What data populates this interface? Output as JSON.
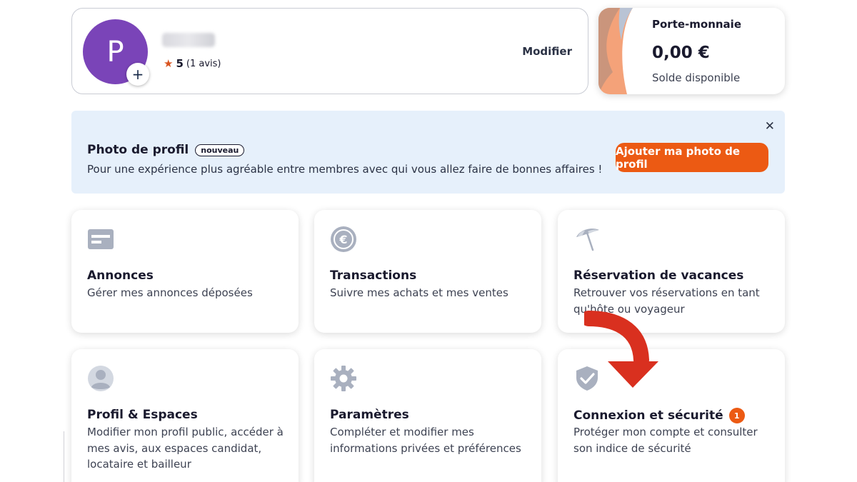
{
  "profile": {
    "avatar_letter": "P",
    "add_photo_symbol": "+",
    "rating_score": "5",
    "rating_count": "(1 avis)",
    "modify_label": "Modifier"
  },
  "wallet": {
    "title": "Porte-monnaie",
    "balance": "0,00 €",
    "subtitle": "Solde disponible"
  },
  "banner": {
    "title": "Photo de profil",
    "badge": "nouveau",
    "description": "Pour une expérience plus agréable entre membres avec qui vous allez faire de bonnes affaires !",
    "cta_label": "Ajouter ma photo de profil",
    "close_symbol": "✕"
  },
  "tiles": [
    {
      "title": "Annonces",
      "description": "Gérer mes annonces déposées",
      "icon": "card-icon"
    },
    {
      "title": "Transactions",
      "description": "Suivre mes achats et mes ventes",
      "icon": "euro-coin-icon"
    },
    {
      "title": "Réservation de vacances",
      "description": "Retrouver vos réservations en tant qu'hôte ou voyageur",
      "icon": "umbrella-icon"
    },
    {
      "title": "Profil & Espaces",
      "description": "Modifier mon profil public, accéder à mes avis, aux espaces candidat, locataire et bailleur",
      "icon": "user-icon"
    },
    {
      "title": "Paramètres",
      "description": "Compléter et modifier mes informations privées et préférences",
      "icon": "gear-icon"
    },
    {
      "title": "Connexion et sécurité",
      "description": "Protéger mon compte et consulter son indice de sécurité",
      "icon": "shield-check-icon",
      "badge": "1"
    }
  ],
  "colors": {
    "accent": "#ec5a13",
    "avatar": "#7a44b8",
    "banner_bg": "#e6f0fb",
    "arrow": "#d9301f",
    "icon_gray": "#a9b0bf"
  }
}
